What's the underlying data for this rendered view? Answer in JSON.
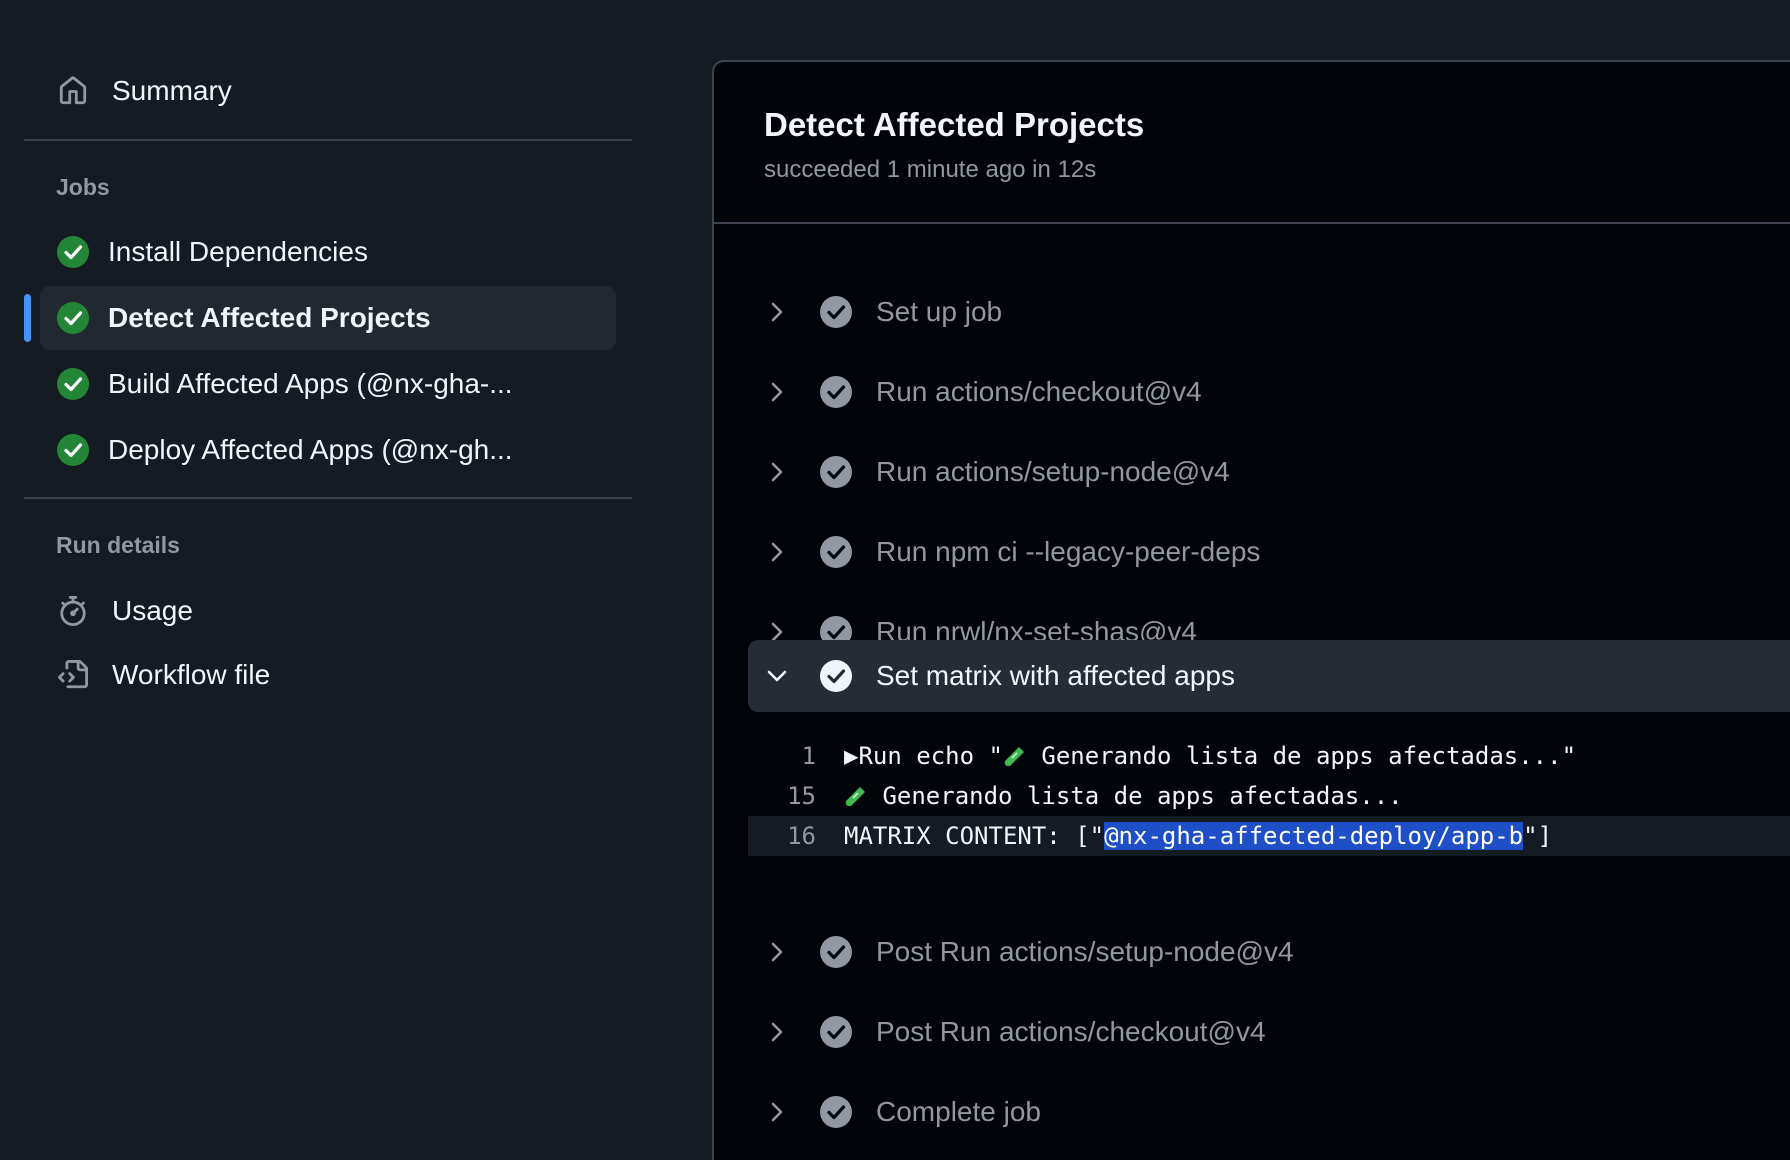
{
  "sidebar": {
    "summary_label": "Summary",
    "jobs_heading": "Jobs",
    "jobs": [
      {
        "label": "Install Dependencies",
        "status": "success"
      },
      {
        "label": "Detect Affected Projects",
        "status": "success",
        "selected": true
      },
      {
        "label": "Build Affected Apps (@nx-gha-...",
        "status": "success"
      },
      {
        "label": "Deploy Affected Apps (@nx-gh...",
        "status": "success"
      }
    ],
    "run_details_heading": "Run details",
    "usage_label": "Usage",
    "workflow_file_label": "Workflow file"
  },
  "job": {
    "title": "Detect Affected Projects",
    "subtitle": "succeeded 1 minute ago in 12s",
    "steps": [
      {
        "name": "Set up job",
        "expanded": false
      },
      {
        "name": "Run actions/checkout@v4",
        "expanded": false
      },
      {
        "name": "Run actions/setup-node@v4",
        "expanded": false
      },
      {
        "name": "Run npm ci --legacy-peer-deps",
        "expanded": false
      },
      {
        "name": "Run nrwl/nx-set-shas@v4",
        "expanded": false
      },
      {
        "name": "Set matrix with affected apps",
        "expanded": true
      },
      {
        "name": "Post Run actions/setup-node@v4",
        "expanded": false
      },
      {
        "name": "Post Run actions/checkout@v4",
        "expanded": false
      },
      {
        "name": "Complete job",
        "expanded": false
      }
    ],
    "log": [
      {
        "num": "1",
        "prefix": "▶Run echo \"",
        "text": " Generando lista de apps afectadas...\""
      },
      {
        "num": "15",
        "text": " Generando lista de apps afectadas..."
      },
      {
        "num": "16",
        "before": "MATRIX CONTENT: [\"",
        "selected": "@nx-gha-affected-deploy/app-b",
        "after": "\"]"
      }
    ]
  },
  "colors": {
    "success": "#238636",
    "accent": "#4493f8",
    "selection": "#1f4fc7"
  },
  "icons": [
    "home-icon",
    "check-circle-icon",
    "stopwatch-icon",
    "file-code-icon",
    "chevron-right-icon",
    "chevron-down-icon",
    "test-tube-icon"
  ]
}
